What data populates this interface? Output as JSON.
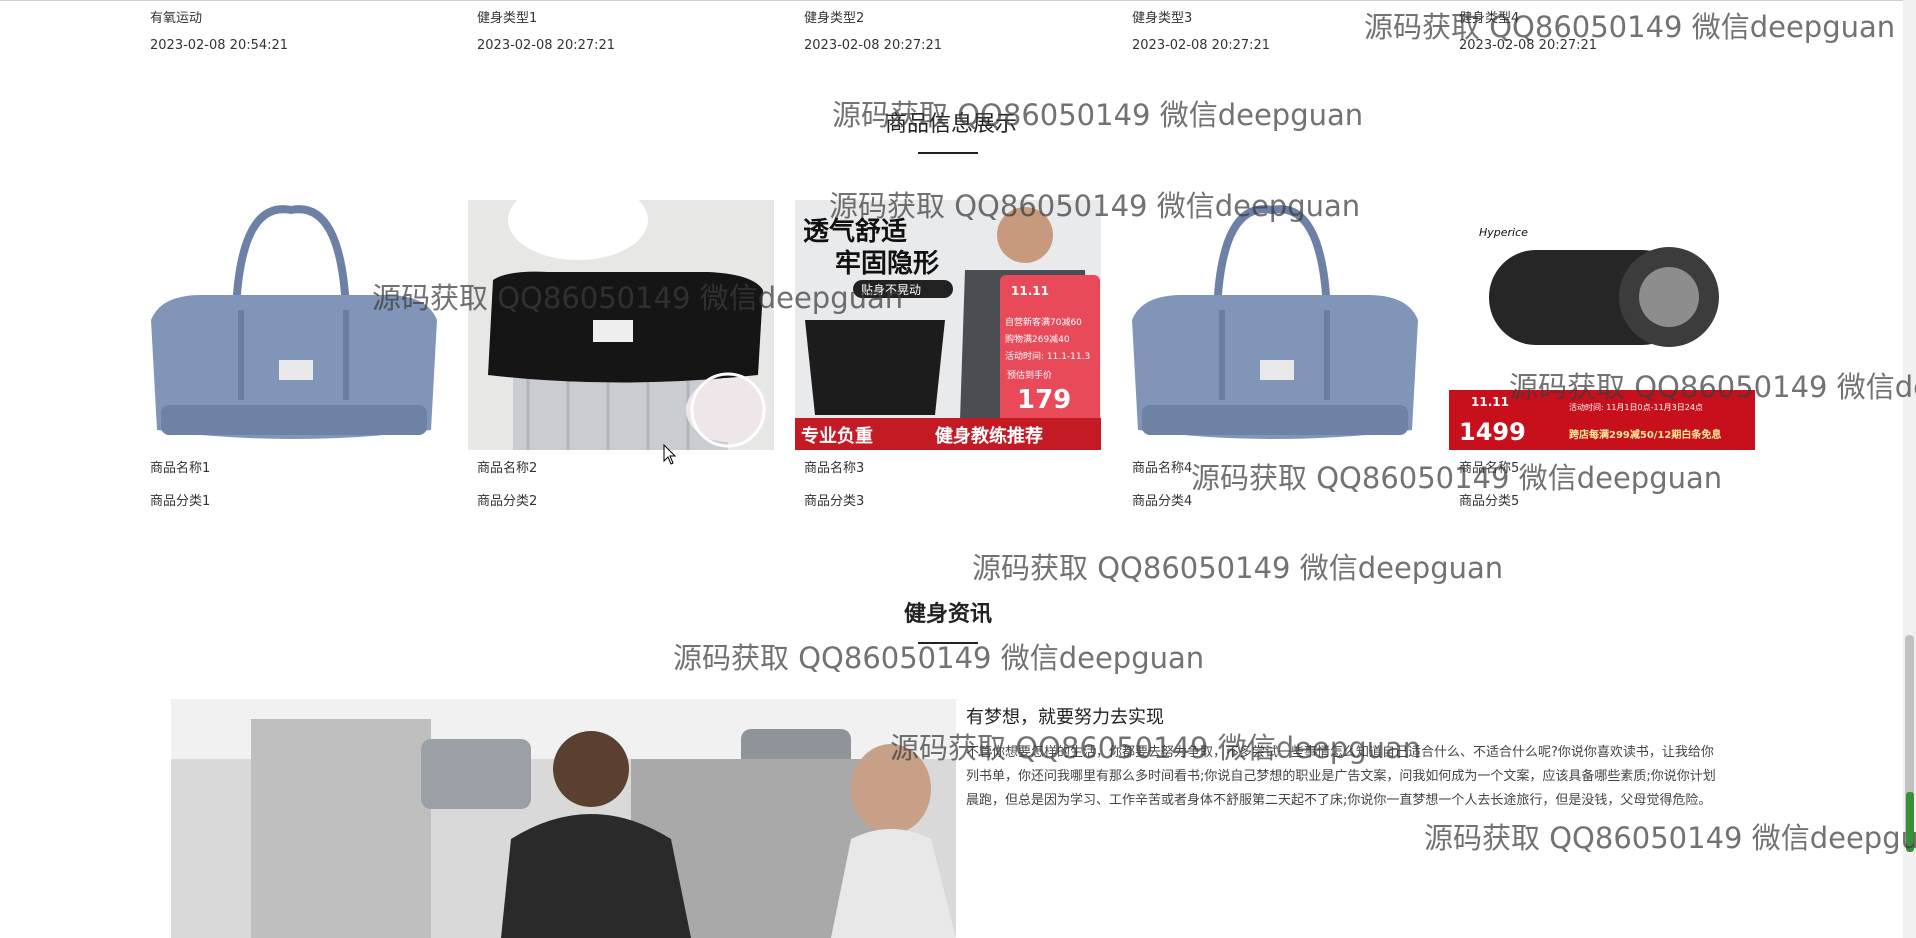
{
  "top_row": {
    "names": [
      "有氧运动",
      "健身类型1",
      "健身类型2",
      "健身类型3",
      "健身类型4"
    ],
    "dates": [
      "2023-02-08 20:54:21",
      "2023-02-08 20:27:21",
      "2023-02-08 20:27:21",
      "2023-02-08 20:27:21",
      "2023-02-08 20:27:21"
    ]
  },
  "products_section": {
    "title": "商品信息展示",
    "items": [
      {
        "name": "商品名称1",
        "category": "商品分类1"
      },
      {
        "name": "商品名称2",
        "category": "商品分类2"
      },
      {
        "name": "商品名称3",
        "category": "商品分类3"
      },
      {
        "name": "商品名称4",
        "category": "商品分类4"
      },
      {
        "name": "商品名称5",
        "category": "商品分类5"
      }
    ],
    "product3_banner": {
      "headline1": "透气舒适",
      "headline2": "牢固隐形",
      "tag": "贴身不晃动",
      "promo1": "11.11",
      "promo_line1": "自营新客满70减60",
      "promo_line2": "购物满269减40",
      "promo_line3": "活动时间: 11.1-11.3",
      "price_label": "预估到手价",
      "price": "179",
      "bottom_left": "专业负重",
      "bottom_right": "健身教练推荐"
    },
    "product5_banner": {
      "brand": "Hyperice",
      "badge": "11.11",
      "price": "1499",
      "promo": "跨店每满299减50/12期白条免息",
      "time": "活动时间: 11月1日0点-11月3日24点"
    }
  },
  "news_section": {
    "title": "健身资讯",
    "headline": "有梦想，就要努力去实现",
    "body": "不管你想要怎样的生活，你都要去努力争取，不多尝试一些事情怎么知道自己适合什么、不适合什么呢?你说你喜欢读书，让我给你列书单，你还问我哪里有那么多时间看书;你说自己梦想的职业是广告文案，问我如何成为一个文案，应该具备哪些素质;你说你计划晨跑，但总是因为学习、工作辛苦或者身体不舒服第二天起不了床;你说你一直梦想一个人去长途旅行，但是没钱，父母觉得危险。"
  },
  "watermark": {
    "text": "源码获取 QQ86050149 微信deepguan"
  },
  "colors": {
    "accent_blue": "#2f6fd6",
    "bag_blue": "#7f93b6",
    "promo_red": "#d9232b"
  },
  "icons": {
    "prev": "chevron-left-icon",
    "next": "chevron-right-icon"
  }
}
